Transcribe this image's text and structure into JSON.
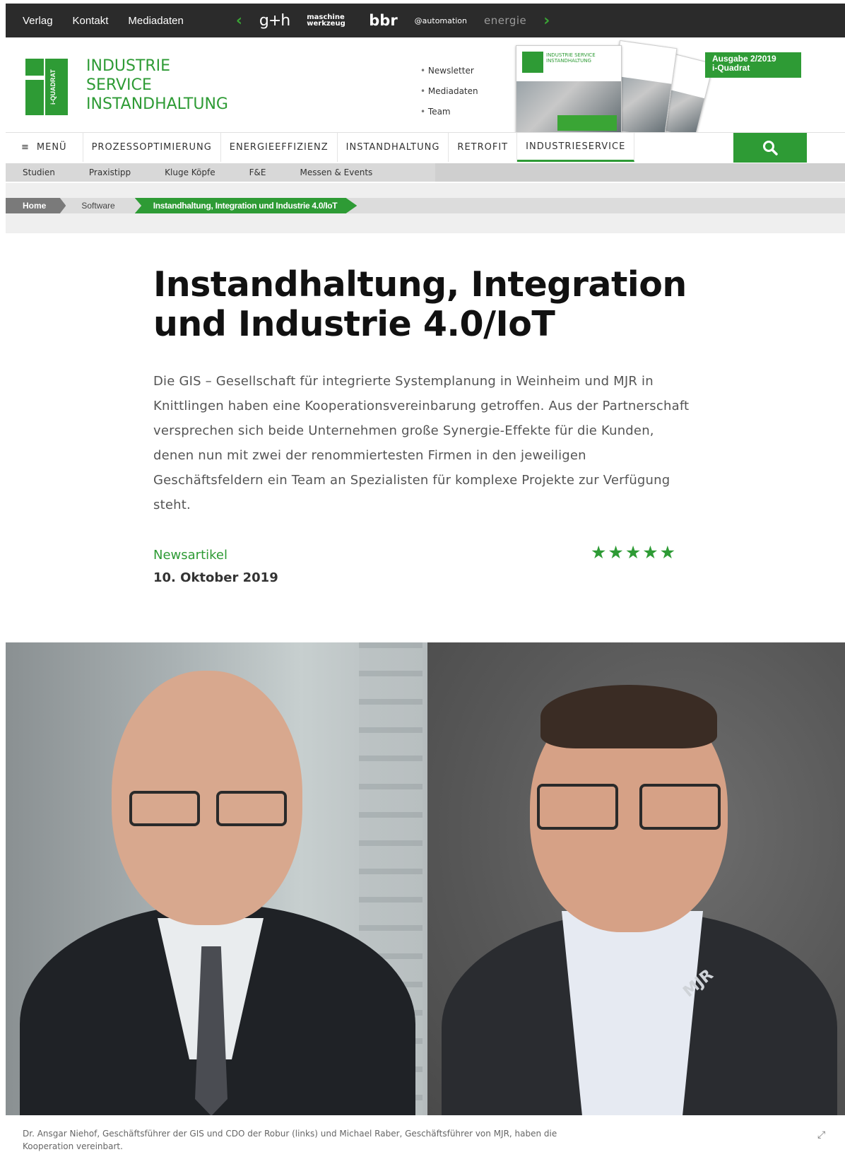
{
  "topbar": {
    "links": [
      "Verlag",
      "Kontakt",
      "Mediadaten"
    ],
    "brands": [
      "g+h",
      "maschine werkzeug",
      "bbr",
      "@automation",
      "energie"
    ]
  },
  "header": {
    "logo_lines": [
      "INDUSTRIE",
      "SERVICE",
      "INSTANDHALTUNG"
    ],
    "logo_vertical": "i-QUADRAT",
    "links": [
      "Newsletter",
      "Mediadaten",
      "Team"
    ],
    "cover_title": "INDUSTRIE SERVICE INSTANDHALTUNG",
    "issue_line1": "Ausgabe 2/2019",
    "issue_line2": "i-Quadrat"
  },
  "nav": {
    "menu_label": "MENÜ",
    "items": [
      "PROZESSOPTIMIERUNG",
      "ENERGIEEFFIZIENZ",
      "INSTANDHALTUNG",
      "RETROFIT",
      "INDUSTRIESERVICE"
    ]
  },
  "subnav": [
    "Studien",
    "Praxistipp",
    "Kluge Köpfe",
    "F&E",
    "Messen & Events"
  ],
  "breadcrumb": [
    "Home",
    "Software",
    "Instandhaltung, Integration und Industrie 4.0/IoT"
  ],
  "article": {
    "title": "Instandhaltung, Integration und Industrie 4.0/IoT",
    "lead": "Die GIS – Gesellschaft für integrierte Systemplanung in Weinheim und MJR in Knittlingen haben eine Kooperationsvereinbarung getroffen. Aus der Partnerschaft versprechen sich beide Unternehmen große Synergie-Effekte für die Kunden, denen nun mit zwei der renommiertesten Firmen in den jeweiligen Geschäftsfeldern ein Team an Spezialisten für komplexe Projekte zur Verfügung steht.",
    "category": "Newsartikel",
    "date": "10. Oktober 2019",
    "rating": 5,
    "stars": "★★★★★"
  },
  "photo": {
    "caption": "Dr. Ansgar Niehof, Geschäftsführer der GIS und CDO der Robur (links) und Michael Raber, Geschäftsführer von MJR, haben die Kooperation vereinbart.",
    "shirt_logo": "MJR"
  },
  "colors": {
    "brand_green": "#2e9b35",
    "topbar": "#2b2b2b",
    "subnav": "#d8d8d8"
  },
  "icons": [
    "menu-icon",
    "search-icon",
    "chevron-left-icon",
    "chevron-right-icon",
    "expand-icon"
  ]
}
